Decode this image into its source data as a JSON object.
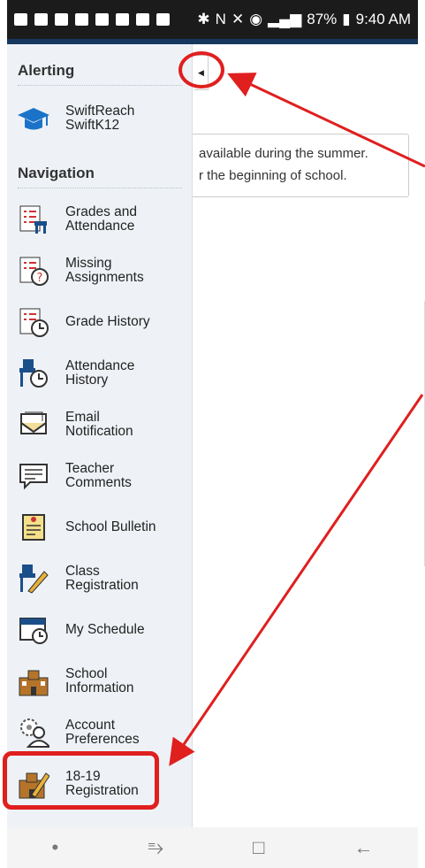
{
  "status_bar": {
    "time": "9:40 AM",
    "battery": "87%"
  },
  "sidebar": {
    "alerting_title": "Alerting",
    "swiftreach_label": "SwiftReach\nSwiftK12",
    "navigation_title": "Navigation",
    "items": [
      {
        "label": "Grades and\nAttendance"
      },
      {
        "label": "Missing\nAssignments"
      },
      {
        "label": "Grade History"
      },
      {
        "label": "Attendance\nHistory"
      },
      {
        "label": "Email\nNotification"
      },
      {
        "label": "Teacher\nComments"
      },
      {
        "label": "School Bulletin"
      },
      {
        "label": "Class\nRegistration"
      },
      {
        "label": "My Schedule"
      },
      {
        "label": "School\nInformation"
      },
      {
        "label": "Account\nPreferences"
      },
      {
        "label": "18-19\nRegistration"
      }
    ]
  },
  "main": {
    "notice_line1": "available during the summer.",
    "notice_line2": "r the beginning of school."
  },
  "colors": {
    "accent_red": "#e01f1f",
    "header_blue": "#16385f"
  }
}
